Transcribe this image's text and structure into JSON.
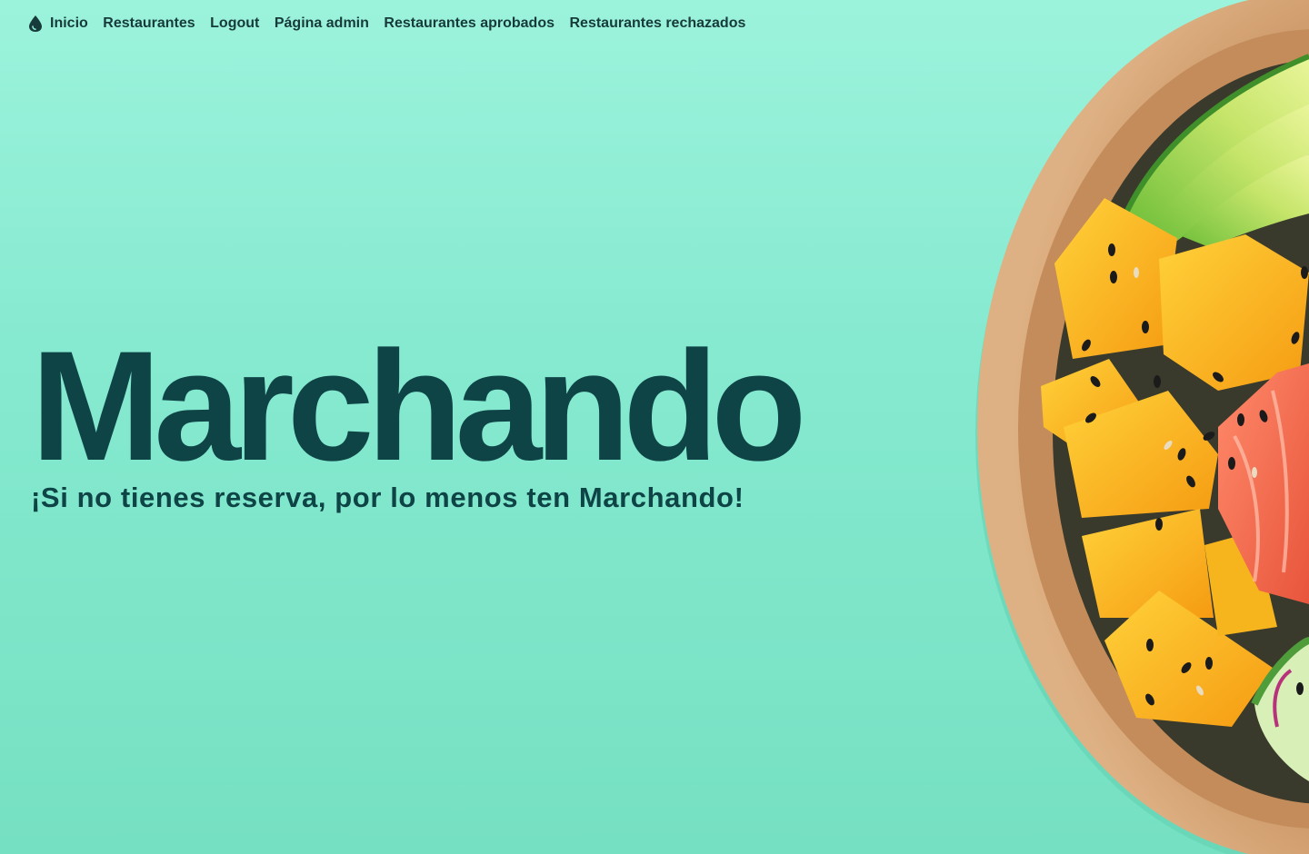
{
  "nav": {
    "logo_icon": "water-drop-icon",
    "items": [
      {
        "label": "Inicio"
      },
      {
        "label": "Restaurantes"
      },
      {
        "label": "Logout"
      },
      {
        "label": "Página admin"
      },
      {
        "label": "Restaurantes aprobados"
      },
      {
        "label": "Restaurantes rechazados"
      }
    ]
  },
  "hero": {
    "title": "Marchando",
    "subtitle": "¡Si no tienes reserva, por lo menos ten Marchando!"
  },
  "image": {
    "subject": "poke-bowl-photo"
  },
  "colors": {
    "background": "#8ceccf",
    "text": "#0f4447",
    "nav_text": "#163b3a"
  }
}
